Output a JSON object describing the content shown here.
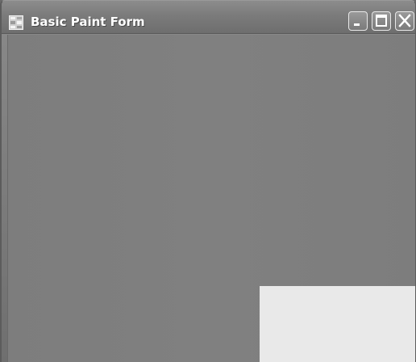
{
  "window": {
    "title": "Basic Paint Form",
    "icons": {
      "app": "application-form-icon",
      "minimize": "minimize-icon",
      "maximize": "maximize-icon",
      "close": "close-icon"
    }
  },
  "canvas": {
    "background_color": "#808080",
    "shape_color": "#e9e9e9"
  }
}
